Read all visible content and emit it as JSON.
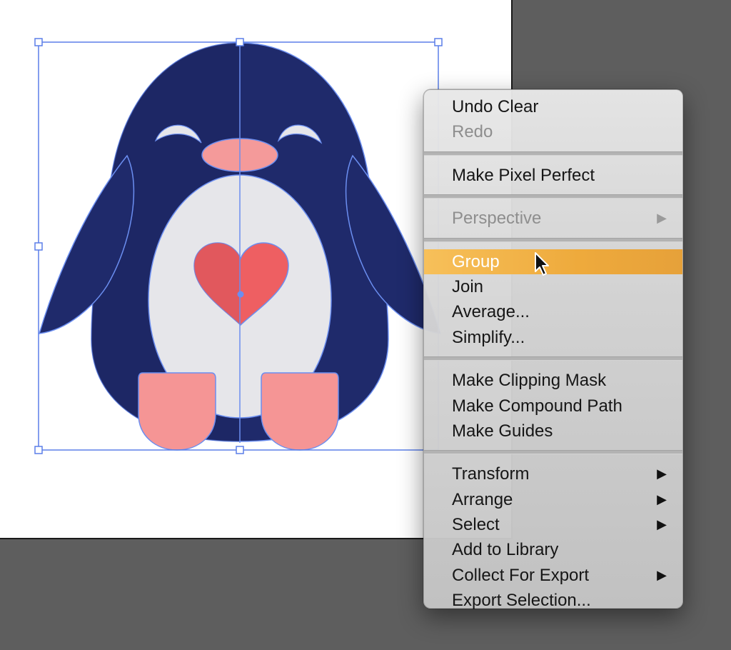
{
  "colors": {
    "penguin_body": "#1f2a6b",
    "penguin_belly": "#e6e6ea",
    "beak": "#f49a9a",
    "heart": "#ee5f62",
    "feet": "#f59595",
    "selection": "#5b7fe8",
    "menu_highlight": "#eeaa3c"
  },
  "context_menu": {
    "groups": [
      [
        {
          "label": "Undo Clear",
          "enabled": true
        },
        {
          "label": "Redo",
          "enabled": false
        }
      ],
      [
        {
          "label": "Make Pixel Perfect",
          "enabled": true
        }
      ],
      [
        {
          "label": "Perspective",
          "enabled": false,
          "submenu_icon": "triangle-right-icon"
        }
      ],
      [
        {
          "label": "Group",
          "enabled": true,
          "highlighted": true
        },
        {
          "label": "Join",
          "enabled": true
        },
        {
          "label": "Average...",
          "enabled": true
        },
        {
          "label": "Simplify...",
          "enabled": true
        }
      ],
      [
        {
          "label": "Make Clipping Mask",
          "enabled": true
        },
        {
          "label": "Make Compound Path",
          "enabled": true
        },
        {
          "label": "Make Guides",
          "enabled": true
        }
      ],
      [
        {
          "label": "Transform",
          "enabled": true,
          "submenu_icon": "triangle-right-icon"
        },
        {
          "label": "Arrange",
          "enabled": true,
          "submenu_icon": "triangle-right-icon"
        },
        {
          "label": "Select",
          "enabled": true,
          "submenu_icon": "triangle-right-icon"
        },
        {
          "label": "Add to Library",
          "enabled": true
        },
        {
          "label": "Collect For Export",
          "enabled": true,
          "submenu_icon": "triangle-right-icon"
        },
        {
          "label": "Export Selection...",
          "enabled": true
        }
      ]
    ]
  }
}
